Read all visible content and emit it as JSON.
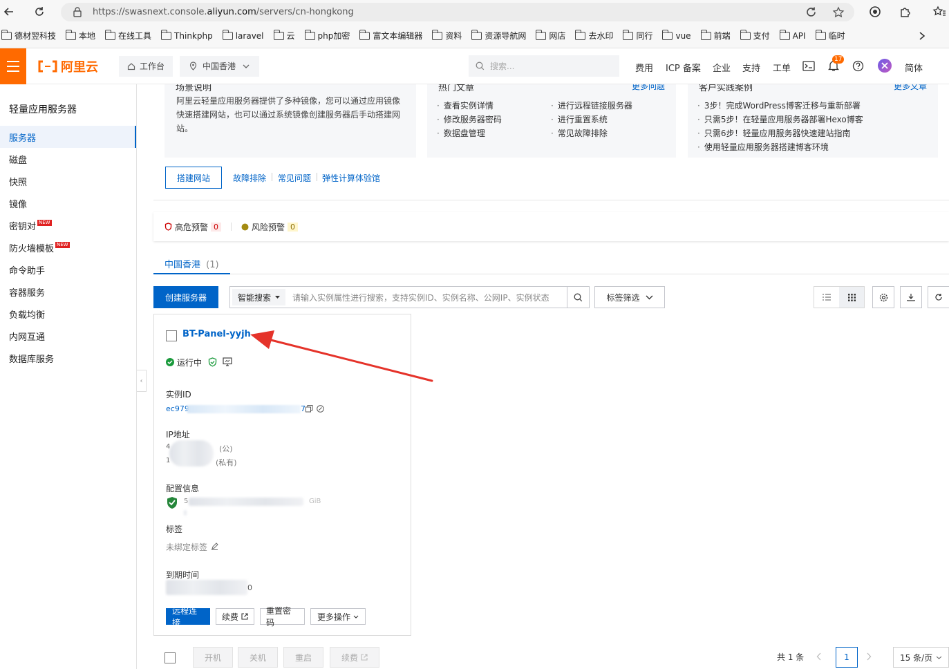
{
  "browser": {
    "url_prefix": "https://swasnext.console.",
    "url_domain": "aliyun.com",
    "url_path": "/servers/cn-hongkong",
    "bookmarks": [
      "德材翌科技",
      "本地",
      "在线工具",
      "Thinkphp",
      "laravel",
      "云",
      "php加密",
      "富文本编辑器",
      "资料",
      "资源导航网",
      "网店",
      "去水印",
      "同行",
      "vue",
      "前端",
      "支付",
      "API",
      "临时"
    ]
  },
  "topnav": {
    "logo": "阿里云",
    "workbench": "工作台",
    "region": "中国香港",
    "search_placeholder": "搜索...",
    "links": [
      "费用",
      "ICP 备案",
      "企业",
      "支持",
      "工单"
    ],
    "notify_count": "17",
    "lang": "简体"
  },
  "sidebar": {
    "title": "轻量应用服务器",
    "items": [
      {
        "label": "服务器",
        "active": true
      },
      {
        "label": "磁盘"
      },
      {
        "label": "快照"
      },
      {
        "label": "镜像"
      },
      {
        "label": "密钥对",
        "new": "NEW"
      },
      {
        "label": "防火墙模板",
        "new": "NEW"
      },
      {
        "label": "命令助手"
      },
      {
        "label": "容器服务"
      },
      {
        "label": "负载均衡"
      },
      {
        "label": "内网互通"
      },
      {
        "label": "数据库服务"
      }
    ]
  },
  "guide": {
    "card1": {
      "title": "场景说明",
      "text": "阿里云轻量应用服务器提供了多种镜像，您可以通过应用镜像快速搭建网站，也可以通过系统镜像创建服务器后手动搭建网站。"
    },
    "card2": {
      "title": "热门文章",
      "more": "更多问题",
      "items": [
        "查看实例详情",
        "修改服务器密码",
        "数据盘管理",
        "进行远程链接服务器",
        "进行重置系统",
        "常见故障排除"
      ]
    },
    "card3": {
      "title": "客户实践案例",
      "more": "更多文章",
      "items": [
        "3步！完成WordPress博客迁移与重新部署",
        "只需5步！在轻量应用服务器部署Hexo博客",
        "只需6步！轻量应用服务器快速建站指南",
        "使用轻量应用服务器搭建博客环境"
      ]
    },
    "build_btn": "搭建网站",
    "links": [
      "故障排除",
      "常见问题",
      "弹性计算体验馆"
    ]
  },
  "alerts": {
    "high_label": "高危预警",
    "high_count": "0",
    "risk_label": "风险预警",
    "risk_count": "0"
  },
  "region_tab": {
    "label": "中国香港",
    "count": "(1)"
  },
  "toolbar": {
    "create": "创建服务器",
    "smart_search": "智能搜索",
    "search_placeholder": "请输入实例属性进行搜索，支持实例ID、实例名称、公网IP、实例状态",
    "tag_filter": "标签筛选"
  },
  "instance": {
    "name": "BT-Panel-yyjh",
    "status": "运行中",
    "id_label": "实例ID",
    "id_prefix": "ec979",
    "id_suffix": "7",
    "ip_label": "IP地址",
    "ip_public": "(公)",
    "ip_private": "(私有)",
    "ip_lead1": "4",
    "ip_lead2": "1",
    "config_label": "配置信息",
    "config_lead": "5",
    "config_tail": "GiB",
    "tag_label": "标签",
    "tag_value": "未绑定标签",
    "expire_label": "到期时间",
    "expire_tail": "0",
    "btn_remote": "远程连接",
    "btn_renew": "续费",
    "btn_reset": "重置密码",
    "btn_more": "更多操作"
  },
  "bottom": {
    "start": "开机",
    "stop": "关机",
    "restart": "重启",
    "renew": "续费",
    "total": "共 1 条",
    "page": "1",
    "page_size": "15 条/页"
  },
  "colors": {
    "accent": "#0064c8",
    "brand": "#ff6a00",
    "arrow": "#e5332a"
  }
}
